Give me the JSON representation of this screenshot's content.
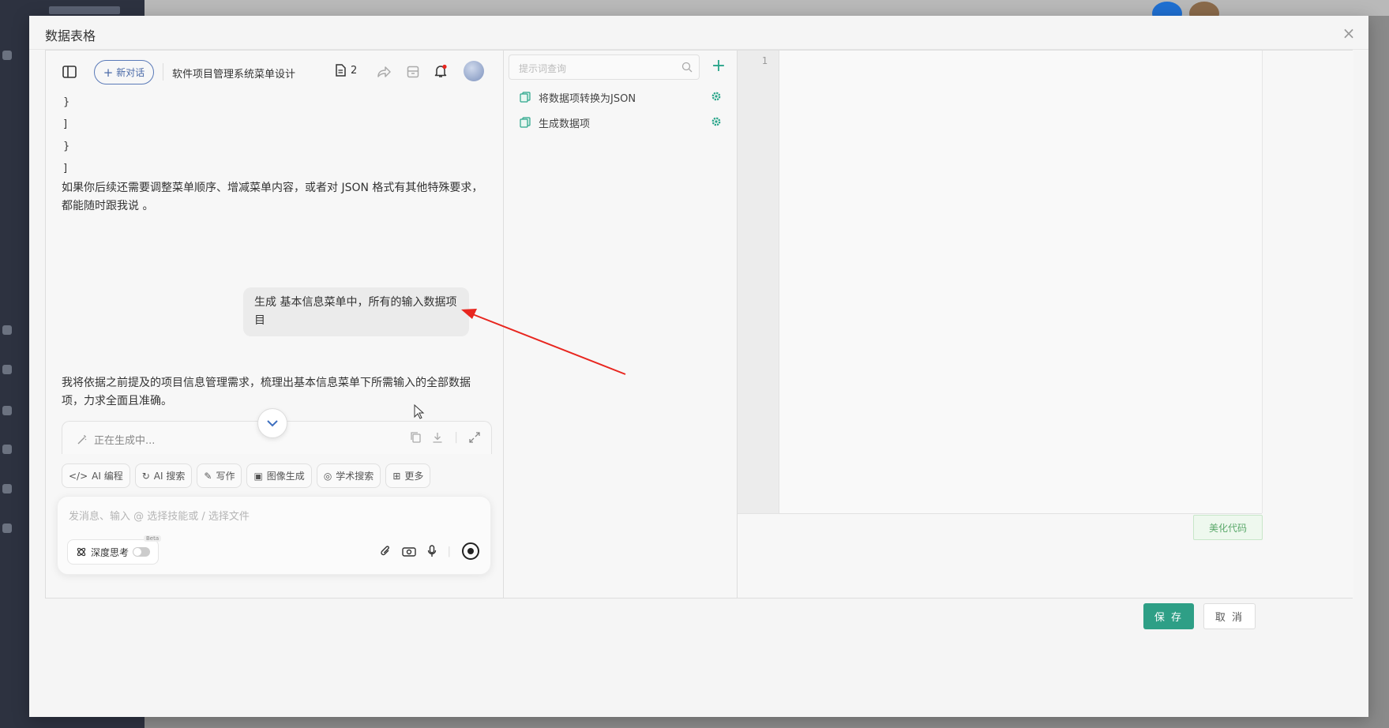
{
  "modal": {
    "title": "数据表格",
    "close_glyph": "×",
    "save_label": "保 存",
    "cancel_label": "取 消"
  },
  "chat": {
    "new_chat_label": "新对话",
    "conversation_title": "软件项目管理系统菜单设计",
    "doc_count": "2",
    "code_tail": [
      "}",
      "]",
      "}",
      "]"
    ],
    "ai_followup": "如果你后续还需要调整菜单顺序、增减菜单内容，或者对 JSON 格式有其他特殊要求，都能随时跟我说 。",
    "user_message": "生成 基本信息菜单中，所有的输入数据项目",
    "ai_reply": "我将依据之前提及的项目信息管理需求，梳理出基本信息菜单下所需输入的全部数据项，力求全面且准确。",
    "generating_status": "正在生成中...",
    "skills": [
      "AI 编程",
      "AI 搜索",
      "写作",
      "图像生成",
      "学术搜索",
      "更多"
    ],
    "input_placeholder": "发消息、输入 @ 选择技能或 / 选择文件",
    "deep_think_label": "深度思考",
    "beta_label": "Beta"
  },
  "prompts": {
    "search_placeholder": "提示词查询",
    "add_glyph": "+",
    "items": [
      "将数据项转换为JSON",
      "生成数据项"
    ]
  },
  "editor": {
    "line_number": "1",
    "beautify_label": "美化代码"
  },
  "colors": {
    "accent": "#2e9f86",
    "link_blue": "#4a6aa8",
    "annotation_arrow": "#e8261f"
  }
}
